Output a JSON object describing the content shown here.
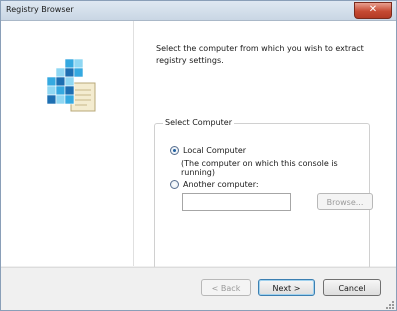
{
  "window": {
    "title": "Registry Browser",
    "close_glyph": "✕"
  },
  "icon": {
    "name": "registry-cubes-icon",
    "colors": {
      "cube_light": "#8fd7f3",
      "cube_mid": "#35a9e0",
      "cube_dark": "#1d6fb2",
      "sheet": "#f4ecd0"
    }
  },
  "content": {
    "intro": "Select the computer from which you wish to extract registry settings."
  },
  "select_computer": {
    "legend": "Select Computer",
    "local": {
      "label": "Local Computer",
      "checked": true,
      "description": "(The computer on which this console is running)"
    },
    "another": {
      "label": "Another computer:",
      "checked": false,
      "input_value": "",
      "browse_label": "Browse..."
    }
  },
  "footer": {
    "back_label": "< Back",
    "next_label": "Next >",
    "cancel_label": "Cancel"
  }
}
